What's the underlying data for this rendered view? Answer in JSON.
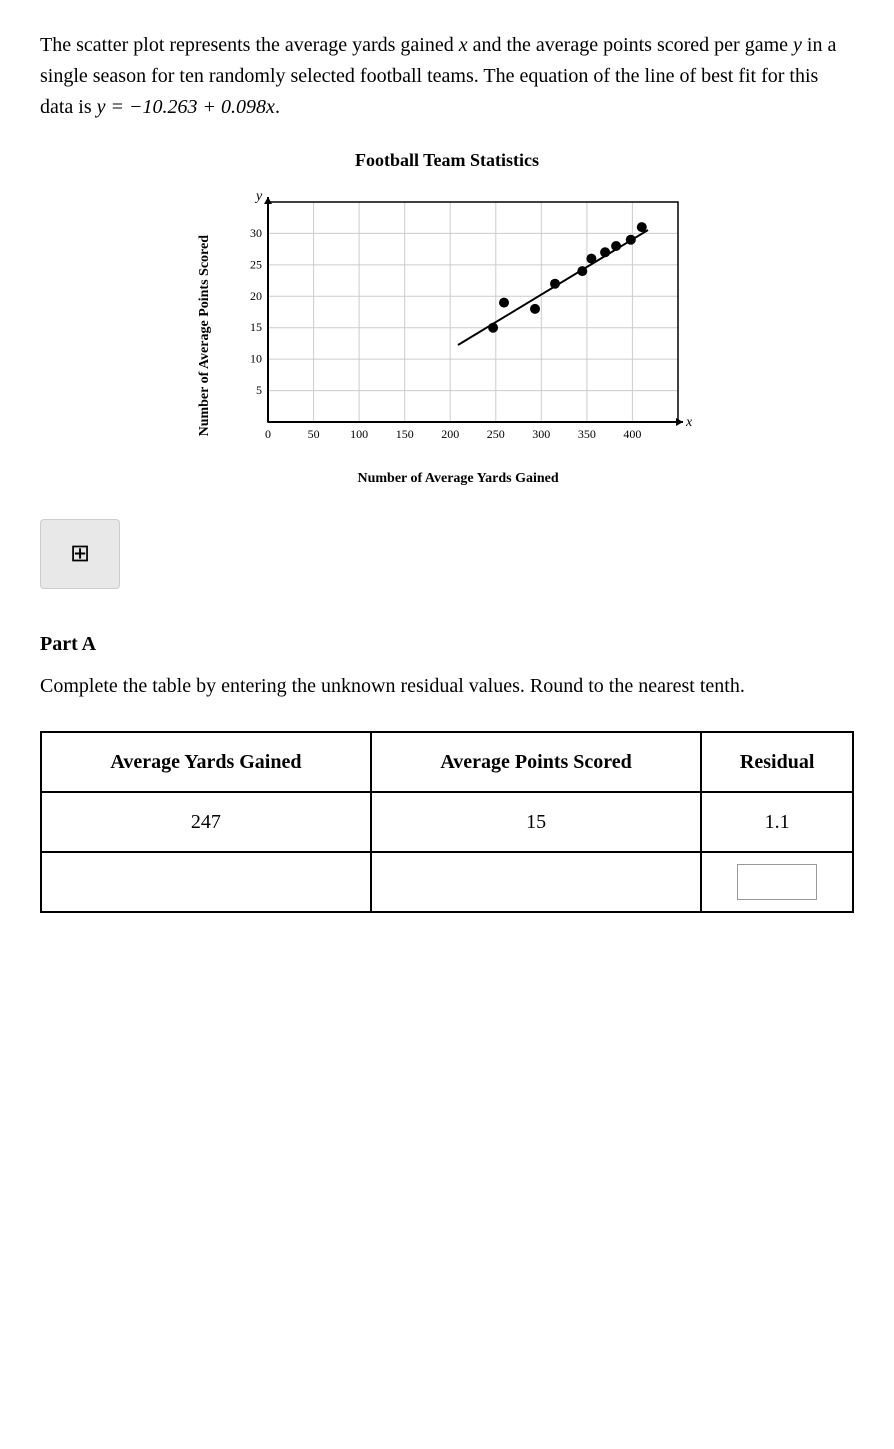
{
  "intro": {
    "paragraph": "The scatter plot represents the average yards gained x and the average points scored per game y in a single season for ten randomly selected football teams. The equation of the line of best fit for this data is",
    "equation_text": "y = −10.263 + 0.098x"
  },
  "chart": {
    "title": "Football Team Statistics",
    "y_axis_label": "Number of Average Points Scored",
    "x_axis_label": "Number of Average Yards Gained",
    "y_axis_var": "y",
    "x_axis_var": "x",
    "x_ticks": [
      "0",
      "50",
      "100",
      "150",
      "200",
      "250",
      "300",
      "350",
      "400"
    ],
    "y_ticks": [
      "5",
      "10",
      "15",
      "20",
      "25",
      "30"
    ],
    "data_points": [
      {
        "x": 247,
        "y": 15
      },
      {
        "x": 259,
        "y": 19
      },
      {
        "x": 293,
        "y": 18
      },
      {
        "x": 315,
        "y": 22
      },
      {
        "x": 345,
        "y": 24
      },
      {
        "x": 355,
        "y": 26
      },
      {
        "x": 370,
        "y": 27
      },
      {
        "x": 382,
        "y": 28
      },
      {
        "x": 398,
        "y": 29
      },
      {
        "x": 410,
        "y": 31
      }
    ]
  },
  "calculator": {
    "icon": "⊞",
    "label": "calculator"
  },
  "part_a": {
    "title": "Part A",
    "description": "Complete the table by entering the unknown residual values. Round to the nearest tenth."
  },
  "table": {
    "headers": [
      "Average Yards Gained",
      "Average Points Scored",
      "Residual"
    ],
    "rows": [
      {
        "yards": "247",
        "points": "15",
        "residual": "1.1",
        "editable": false
      },
      {
        "yards": "",
        "points": "",
        "residual": "",
        "editable": true
      }
    ]
  }
}
